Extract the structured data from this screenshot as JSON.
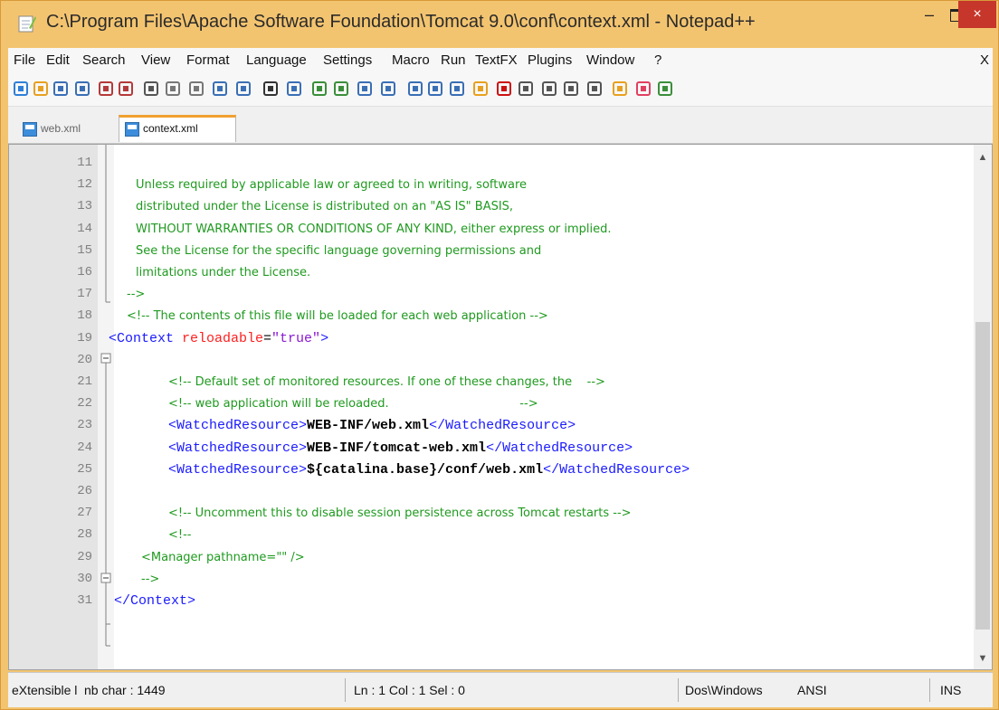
{
  "window": {
    "title": "C:\\Program Files\\Apache Software Foundation\\Tomcat 9.0\\conf\\context.xml - Notepad++",
    "min_glyph": "–",
    "close_glyph": "×"
  },
  "menu": {
    "items": [
      "File",
      "Edit",
      "Search",
      "View",
      "Format",
      "Language",
      "Settings",
      "Macro",
      "Run",
      "TextFX",
      "Plugins",
      "Window",
      "?"
    ],
    "close_x": "X"
  },
  "toolbar": {
    "icons": [
      "new-file-icon",
      "open-file-icon",
      "save-icon",
      "save-all-icon",
      "close-icon",
      "close-all-icon",
      "cut-icon",
      "copy-icon",
      "paste-icon",
      "undo-icon",
      "redo-icon",
      "find-icon",
      "replace-icon",
      "zoom-in-icon",
      "zoom-out-icon",
      "sync-vertical-icon",
      "sync-horizontal-icon",
      "word-wrap-icon",
      "show-all-chars-icon",
      "indent-guide-icon",
      "user-lang-icon",
      "record-macro-icon",
      "stop-record-icon",
      "play-macro-icon",
      "run-macro-multiple-icon",
      "save-macro-icon",
      "monitor-icon",
      "favorite-icon",
      "plugin-icon"
    ]
  },
  "tabs": [
    {
      "label": "web.xml",
      "active": false
    },
    {
      "label": "context.xml",
      "active": true
    }
  ],
  "editor": {
    "lines": [
      {
        "n": "11",
        "parts": []
      },
      {
        "n": "12",
        "parts": [
          {
            "c": "cm",
            "t": "Unless required by applicable law or agreed to in writing, software"
          }
        ]
      },
      {
        "n": "13",
        "parts": [
          {
            "c": "cm",
            "t": "distributed under the License is distributed on an \"AS IS\" BASIS,"
          }
        ]
      },
      {
        "n": "14",
        "parts": [
          {
            "c": "cm",
            "t": "WITHOUT WARRANTIES OR CONDITIONS OF ANY KIND, either express or implied."
          }
        ]
      },
      {
        "n": "15",
        "parts": [
          {
            "c": "cm",
            "t": "See the License for the specific language governing permissions and"
          }
        ]
      },
      {
        "n": "16",
        "parts": [
          {
            "c": "cm",
            "t": "limitations under the License."
          }
        ]
      },
      {
        "n": "17",
        "parts": [
          {
            "c": "cm",
            "t": "-->"
          }
        ]
      },
      {
        "n": "18",
        "parts": [
          {
            "c": "cm",
            "t": "<!-- The contents of this file will be loaded for each web application -->"
          }
        ]
      },
      {
        "n": "19",
        "parts": [
          {
            "c": "tg",
            "t": "<Context "
          },
          {
            "c": "tg at",
            "t": "reloadable"
          },
          {
            "c": "tg eq",
            "t": "="
          },
          {
            "c": "tg vl",
            "t": "\"true\""
          },
          {
            "c": "tg",
            "t": ">"
          }
        ]
      },
      {
        "n": "20",
        "parts": []
      },
      {
        "n": "21",
        "parts": [
          {
            "c": "cm",
            "t": "<!-- Default set of monitored resources. If one of these changes, the    -->"
          }
        ]
      },
      {
        "n": "22",
        "parts": [
          {
            "c": "cm",
            "t": "<!-- web application will be reloaded.                                   -->"
          }
        ]
      },
      {
        "n": "23",
        "parts": [
          {
            "c": "tg",
            "t": "<WatchedResource>"
          },
          {
            "c": "tg tx",
            "t": "WEB-INF/web.xml"
          },
          {
            "c": "tg",
            "t": "</WatchedResource>"
          }
        ]
      },
      {
        "n": "24",
        "parts": [
          {
            "c": "tg",
            "t": "<WatchedResource>"
          },
          {
            "c": "tg tx",
            "t": "WEB-INF/tomcat-web.xml"
          },
          {
            "c": "tg",
            "t": "</WatchedResource>"
          }
        ]
      },
      {
        "n": "25",
        "parts": [
          {
            "c": "tg",
            "t": "<WatchedResource>"
          },
          {
            "c": "tg tx",
            "t": "${catalina.base}/conf/web.xml"
          },
          {
            "c": "tg",
            "t": "</WatchedResource>"
          }
        ]
      },
      {
        "n": "26",
        "parts": []
      },
      {
        "n": "27",
        "parts": [
          {
            "c": "cm",
            "t": "<!-- Uncomment this to disable session persistence across Tomcat restarts -->"
          }
        ]
      },
      {
        "n": "28",
        "parts": [
          {
            "c": "cm",
            "t": "<!--"
          }
        ]
      },
      {
        "n": "29",
        "parts": [
          {
            "c": "cm",
            "t": "<Manager pathname=\"\" />"
          }
        ]
      },
      {
        "n": "30",
        "parts": [
          {
            "c": "cm",
            "t": "-->"
          }
        ]
      },
      {
        "n": "31",
        "parts": [
          {
            "c": "tg",
            "t": "</Context>"
          }
        ]
      }
    ]
  },
  "status": {
    "lang": "eXtensible l",
    "chars": "nb char : 1449",
    "pos": "Ln : 1    Col : 1    Sel : 0",
    "eol": "Dos\\Windows",
    "enc": "ANSI",
    "mode": "INS"
  },
  "colors": {
    "comment": "#1f9a1f",
    "tag": "#1a1aff",
    "attr": "#ff2020",
    "value": "#8a1ad0",
    "accent": "#f0a030"
  }
}
